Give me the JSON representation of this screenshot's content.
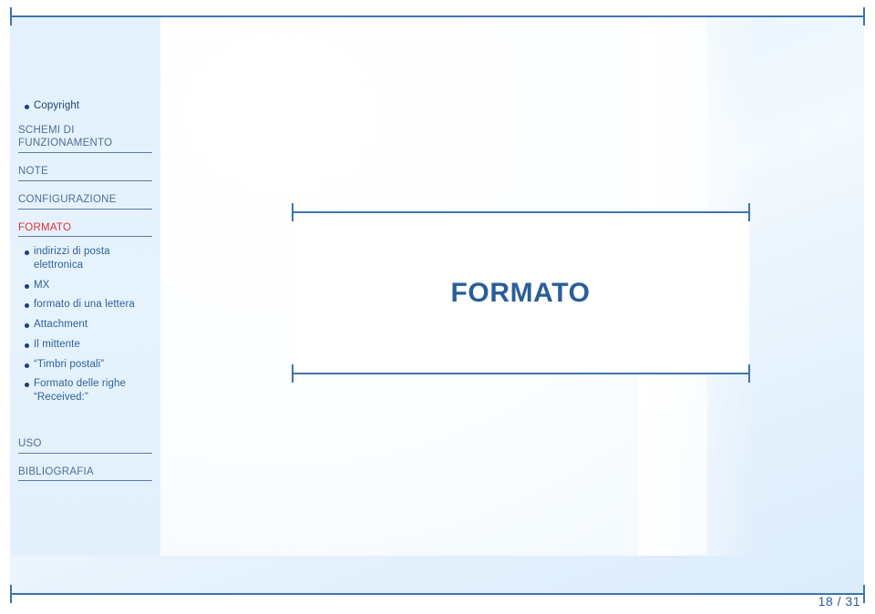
{
  "slide": {
    "title": "FORMATO",
    "page_indicator": "18 / 31"
  },
  "colors": {
    "accent_blue": "#2a5e97",
    "rule_blue": "#3d74ae",
    "active_red": "#e03131",
    "section_slate": "#4f6f92",
    "bullet_navy": "#1e3f73",
    "panel_bg": "#e3f1fd"
  },
  "sidebar": {
    "top_bullet": {
      "label": "Copyright",
      "icon": "bullet-dot-icon"
    },
    "sections": [
      {
        "id": "schemi",
        "label": "SCHEMI DI FUNZIONAMENTO",
        "active": false
      },
      {
        "id": "note",
        "label": "NOTE",
        "active": false
      },
      {
        "id": "configurazione",
        "label": "CONFIGURAZIONE",
        "active": false
      },
      {
        "id": "formato",
        "label": "FORMATO",
        "active": true
      }
    ],
    "formato_items": [
      "indirizzi di posta elettronica",
      "MX",
      "formato di una lettera",
      "Attachment",
      "Il mittente",
      "“Timbri postali”",
      "Formato delle righe “Received:”"
    ],
    "sections_after": [
      {
        "id": "uso",
        "label": "USO",
        "active": false
      },
      {
        "id": "bibliografia",
        "label": "BIBLIOGRAFIA",
        "active": false
      }
    ]
  },
  "crop_marks": {
    "icon": "crop-mark-plus-icon",
    "count": 8
  }
}
